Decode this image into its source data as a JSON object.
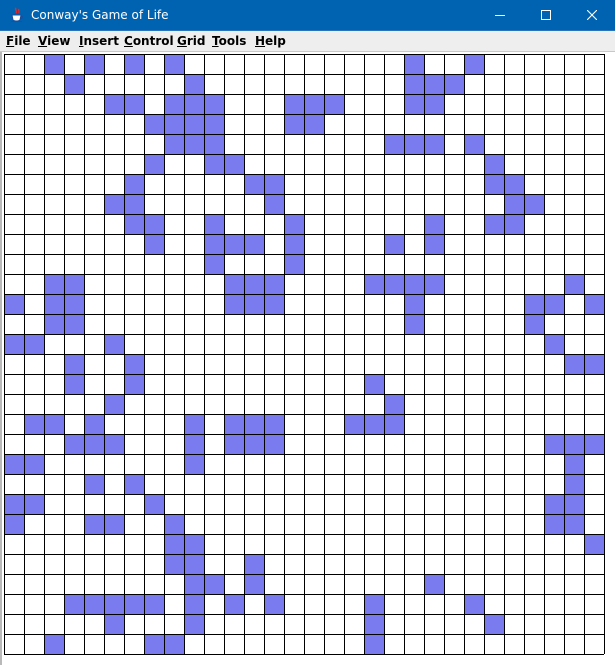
{
  "window": {
    "title": "Conway's Game of Life",
    "icon": "java-coffee-cup-icon",
    "controls": [
      "minimize-icon",
      "maximize-icon",
      "close-icon"
    ]
  },
  "menu": {
    "items": [
      {
        "mnemonic": "F",
        "rest": "ile"
      },
      {
        "mnemonic": "V",
        "rest": "iew"
      },
      {
        "mnemonic": "I",
        "rest": "nsert"
      },
      {
        "mnemonic": "C",
        "rest": "ontrol"
      },
      {
        "mnemonic": "G",
        "rest": "rid"
      },
      {
        "mnemonic": "T",
        "rest": "ools"
      },
      {
        "mnemonic": "H",
        "rest": "elp"
      }
    ]
  },
  "grid": {
    "columns": 30,
    "rows": 30,
    "live_color": "#7b7bf0",
    "dead_color": "#ffffff",
    "line_color": "#000000",
    "live_cells": [
      [
        0,
        2
      ],
      [
        0,
        4
      ],
      [
        0,
        6
      ],
      [
        0,
        8
      ],
      [
        0,
        20
      ],
      [
        0,
        23
      ],
      [
        1,
        3
      ],
      [
        1,
        9
      ],
      [
        1,
        20
      ],
      [
        1,
        21
      ],
      [
        1,
        22
      ],
      [
        2,
        5
      ],
      [
        2,
        6
      ],
      [
        2,
        8
      ],
      [
        2,
        9
      ],
      [
        2,
        10
      ],
      [
        2,
        14
      ],
      [
        2,
        15
      ],
      [
        2,
        16
      ],
      [
        2,
        20
      ],
      [
        2,
        21
      ],
      [
        3,
        7
      ],
      [
        3,
        8
      ],
      [
        3,
        9
      ],
      [
        3,
        10
      ],
      [
        3,
        14
      ],
      [
        3,
        15
      ],
      [
        4,
        8
      ],
      [
        4,
        9
      ],
      [
        4,
        10
      ],
      [
        4,
        19
      ],
      [
        4,
        20
      ],
      [
        4,
        21
      ],
      [
        4,
        23
      ],
      [
        5,
        7
      ],
      [
        5,
        10
      ],
      [
        5,
        11
      ],
      [
        5,
        24
      ],
      [
        6,
        6
      ],
      [
        6,
        12
      ],
      [
        6,
        13
      ],
      [
        6,
        24
      ],
      [
        6,
        25
      ],
      [
        7,
        5
      ],
      [
        7,
        6
      ],
      [
        7,
        13
      ],
      [
        7,
        25
      ],
      [
        7,
        26
      ],
      [
        8,
        6
      ],
      [
        8,
        7
      ],
      [
        8,
        10
      ],
      [
        8,
        14
      ],
      [
        8,
        21
      ],
      [
        8,
        24
      ],
      [
        8,
        25
      ],
      [
        9,
        7
      ],
      [
        9,
        10
      ],
      [
        9,
        11
      ],
      [
        9,
        12
      ],
      [
        9,
        14
      ],
      [
        9,
        19
      ],
      [
        9,
        21
      ],
      [
        10,
        10
      ],
      [
        10,
        14
      ],
      [
        11,
        2
      ],
      [
        11,
        3
      ],
      [
        11,
        11
      ],
      [
        11,
        12
      ],
      [
        11,
        13
      ],
      [
        11,
        18
      ],
      [
        11,
        19
      ],
      [
        11,
        20
      ],
      [
        11,
        21
      ],
      [
        11,
        28
      ],
      [
        12,
        0
      ],
      [
        12,
        2
      ],
      [
        12,
        3
      ],
      [
        12,
        11
      ],
      [
        12,
        12
      ],
      [
        12,
        13
      ],
      [
        12,
        20
      ],
      [
        12,
        26
      ],
      [
        12,
        27
      ],
      [
        12,
        29
      ],
      [
        13,
        2
      ],
      [
        13,
        3
      ],
      [
        13,
        20
      ],
      [
        13,
        26
      ],
      [
        14,
        0
      ],
      [
        14,
        1
      ],
      [
        14,
        5
      ],
      [
        14,
        27
      ],
      [
        15,
        3
      ],
      [
        15,
        6
      ],
      [
        15,
        28
      ],
      [
        15,
        29
      ],
      [
        16,
        3
      ],
      [
        16,
        6
      ],
      [
        16,
        18
      ],
      [
        17,
        5
      ],
      [
        17,
        19
      ],
      [
        18,
        1
      ],
      [
        18,
        2
      ],
      [
        18,
        4
      ],
      [
        18,
        9
      ],
      [
        18,
        11
      ],
      [
        18,
        12
      ],
      [
        18,
        13
      ],
      [
        18,
        17
      ],
      [
        18,
        18
      ],
      [
        18,
        19
      ],
      [
        19,
        3
      ],
      [
        19,
        4
      ],
      [
        19,
        5
      ],
      [
        19,
        9
      ],
      [
        19,
        11
      ],
      [
        19,
        12
      ],
      [
        19,
        13
      ],
      [
        19,
        27
      ],
      [
        19,
        28
      ],
      [
        19,
        29
      ],
      [
        20,
        0
      ],
      [
        20,
        1
      ],
      [
        20,
        9
      ],
      [
        20,
        28
      ],
      [
        21,
        4
      ],
      [
        21,
        6
      ],
      [
        21,
        28
      ],
      [
        22,
        0
      ],
      [
        22,
        1
      ],
      [
        22,
        7
      ],
      [
        22,
        27
      ],
      [
        22,
        28
      ],
      [
        23,
        0
      ],
      [
        23,
        4
      ],
      [
        23,
        5
      ],
      [
        23,
        8
      ],
      [
        23,
        27
      ],
      [
        23,
        28
      ],
      [
        24,
        8
      ],
      [
        24,
        9
      ],
      [
        24,
        29
      ],
      [
        25,
        8
      ],
      [
        25,
        9
      ],
      [
        25,
        12
      ],
      [
        26,
        9
      ],
      [
        26,
        10
      ],
      [
        26,
        12
      ],
      [
        26,
        21
      ],
      [
        27,
        3
      ],
      [
        27,
        4
      ],
      [
        27,
        5
      ],
      [
        27,
        6
      ],
      [
        27,
        7
      ],
      [
        27,
        9
      ],
      [
        27,
        11
      ],
      [
        27,
        13
      ],
      [
        27,
        18
      ],
      [
        27,
        23
      ],
      [
        28,
        5
      ],
      [
        28,
        9
      ],
      [
        28,
        18
      ],
      [
        28,
        24
      ],
      [
        29,
        2
      ],
      [
        29,
        7
      ],
      [
        29,
        8
      ],
      [
        29,
        18
      ]
    ]
  }
}
